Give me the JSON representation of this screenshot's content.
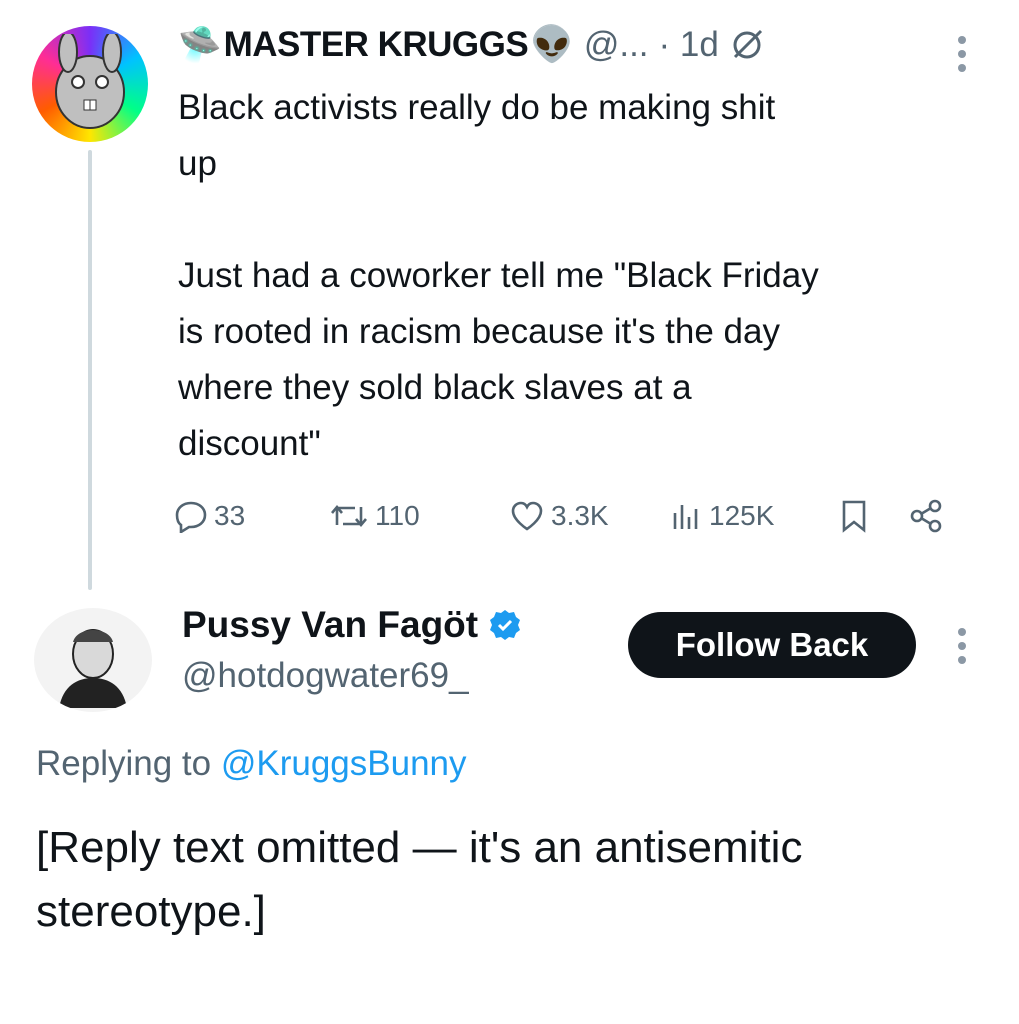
{
  "parent_post": {
    "display_name": "MASTER KRUGGS",
    "name_prefix_emoji": "🛸",
    "name_suffix_emoji": "👽",
    "handle": "@...",
    "time": "· 1d",
    "text": "Black activists really do be making shit\nup\n\nJust had a coworker tell me \"Black Friday\nis rooted in racism because it's the day\nwhere they sold black slaves at a\ndiscount\"",
    "stats": {
      "replies": "33",
      "reposts": "110",
      "likes": "3.3K",
      "views": "125K"
    }
  },
  "reply_post": {
    "display_name": "Pussy Van Fagöt",
    "handle": "@hotdogwater69_",
    "follow_label": "Follow Back",
    "replying_prefix": "Replying to",
    "replying_to": "@KruggsBunny",
    "text": "[Reply text omitted — it's an antisemitic stereotype.]"
  },
  "colors": {
    "link": "#1d9bf0",
    "muted": "#536471",
    "verified": "#1d9bf0",
    "button_bg": "#0f1419"
  }
}
